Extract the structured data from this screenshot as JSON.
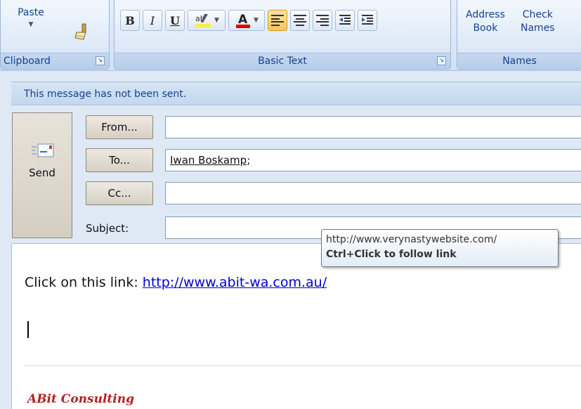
{
  "ribbon": {
    "clipboard": {
      "paste_label": "Paste",
      "group_label": "Clipboard"
    },
    "basic_text": {
      "group_label": "Basic Text",
      "bold": "B",
      "italic": "I",
      "underline": "U",
      "highlight_icon": "highlight-icon",
      "font_color_icon": "font-color-icon"
    },
    "names": {
      "address_book_line1": "Address",
      "address_book_line2": "Book",
      "check_names_line1": "Check",
      "check_names_line2": "Names",
      "group_label": "Names"
    }
  },
  "infobar": {
    "text": "This message has not been sent."
  },
  "header": {
    "send_label": "Send",
    "from_label": "From...",
    "to_label": "To...",
    "cc_label": "Cc...",
    "subject_label": "Subject:",
    "from_value": "",
    "to_value": "Iwan Boskamp",
    "to_separator": ";",
    "cc_value": "",
    "subject_value": ""
  },
  "body": {
    "prefix": "Click on this link: ",
    "link_text": "http://www.abit-wa.com.au/",
    "signature": "ABit Consulting"
  },
  "tooltip": {
    "url": "http://www.verynastywebsite.com/",
    "hint": "Ctrl+Click to follow link"
  },
  "colors": {
    "accent": "#15428b",
    "link": "#0000cc",
    "signature": "#b22222",
    "font_color_bar": "#e00000"
  }
}
